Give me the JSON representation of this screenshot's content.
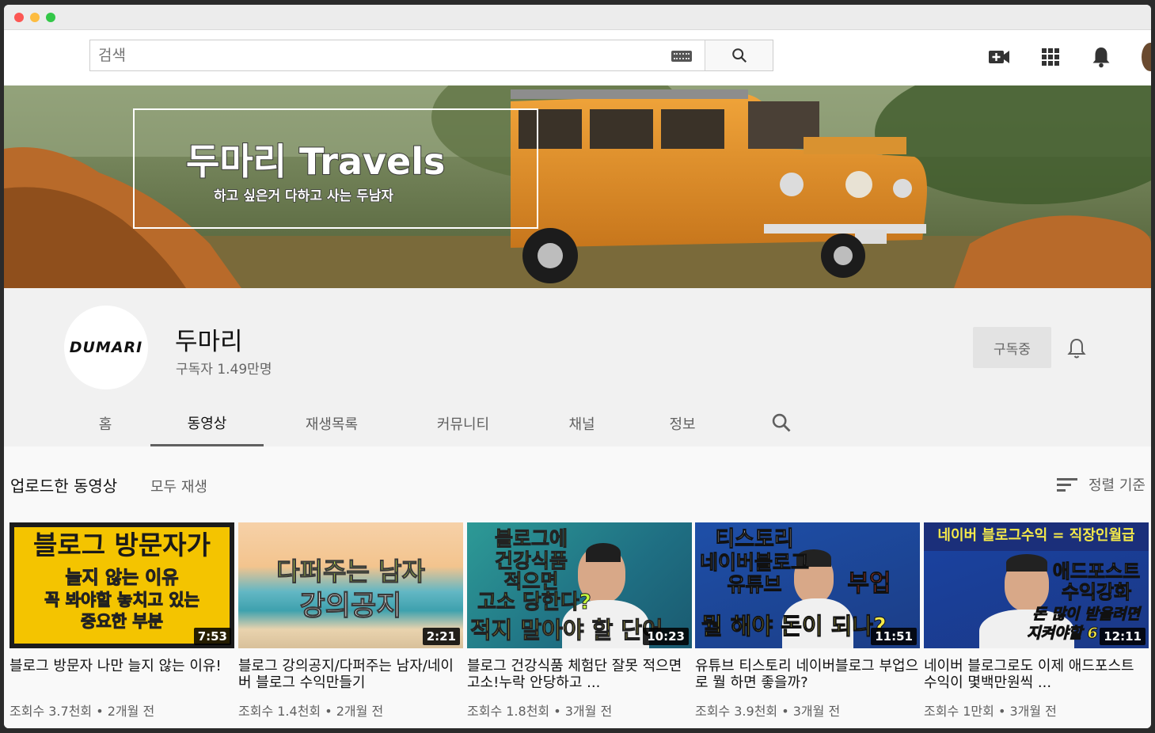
{
  "search": {
    "placeholder": "검색"
  },
  "masthead": {
    "icons": [
      "create-video-icon",
      "apps-grid-icon",
      "notifications-bell-icon"
    ]
  },
  "banner": {
    "title": "두마리 Travels",
    "subtitle": "하고 싶은거 다하고 사는 두남자"
  },
  "channel": {
    "avatar_text": "DUMARI",
    "name": "두마리",
    "subscribers": "구독자 1.49만명",
    "subscribe_label": "구독중"
  },
  "tabs": [
    "홈",
    "동영상",
    "재생목록",
    "커뮤니티",
    "채널",
    "정보"
  ],
  "active_tab": "동영상",
  "section": {
    "title": "업로드한 동영상",
    "play_all": "모두 재생",
    "sort_label": "정렬 기준"
  },
  "videos": [
    {
      "title": "블로그 방문자 나만 늘지 않는 이유!",
      "meta": "조회수 3.7천회 • 2개월 전",
      "duration": "7:53",
      "thumb_lines": [
        "블로그 방문자가",
        "늘지 않는 이유",
        "꼭 봐야할 놓치고 있는",
        "중요한 부분"
      ]
    },
    {
      "title": "블로그 강의공지/다퍼주는 남자/네이버 블로그 수익만들기",
      "meta": "조회수 1.4천회 • 2개월 전",
      "duration": "2:21",
      "thumb_lines": [
        "다퍼주는 남자",
        "강의공지"
      ]
    },
    {
      "title": "블로그 건강식품 체험단 잘못 적으면 고소!누락 안당하고 ...",
      "meta": "조회수 1.8천회 • 3개월 전",
      "duration": "10:23",
      "thumb_lines": [
        "블로그에",
        "건강식품",
        "적으면",
        "고소 당한다?",
        "적지 말아야 할 단어"
      ]
    },
    {
      "title": "유튜브 티스토리 네이버블로그 부업으로 뭘 하면 좋을까?",
      "meta": "조회수 3.9천회 • 3개월 전",
      "duration": "11:51",
      "thumb_lines": [
        "티스토리",
        "네이버블로그",
        "유튜브",
        "부업",
        "뭘 해야 돈이 되나?"
      ]
    },
    {
      "title": "네이버 블로그로도 이제 애드포스트 수익이 몇백만원씩 ...",
      "meta": "조회수 1만회 • 3개월 전",
      "duration": "12:11",
      "thumb_lines": [
        "네이버 블로그수익 = 직장인월급",
        "애드포스트",
        "수익강화",
        "돈 많이 받을려면",
        "지켜야할 6"
      ]
    }
  ],
  "colors": {
    "subscribe_bg": "#e3e3e3",
    "active_tab_underline": "#606060"
  }
}
